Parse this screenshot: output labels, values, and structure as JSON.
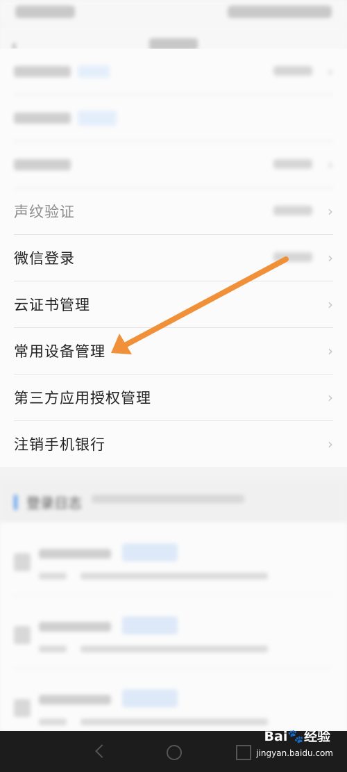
{
  "list": {
    "items": [
      {
        "label": "",
        "blurred": true,
        "has_tag": true,
        "has_status": true
      },
      {
        "label": "",
        "blurred": true,
        "has_tag": true,
        "has_status": false
      },
      {
        "label": "",
        "blurred": true,
        "has_tag": false,
        "has_status": true
      },
      {
        "label": "声纹验证",
        "blurred": false,
        "dim": true,
        "has_tag": false,
        "has_status": true
      },
      {
        "label": "微信登录",
        "blurred": false,
        "dim": false,
        "has_tag": false,
        "has_status": true
      },
      {
        "label": "云证书管理",
        "blurred": false,
        "dim": false,
        "has_tag": false,
        "has_status": false
      },
      {
        "label": "常用设备管理",
        "blurred": false,
        "dim": false,
        "has_tag": false,
        "has_status": false
      },
      {
        "label": "第三方应用授权管理",
        "blurred": false,
        "dim": false,
        "has_tag": false,
        "has_status": false
      },
      {
        "label": "注销手机银行",
        "blurred": false,
        "dim": false,
        "has_tag": false,
        "has_status": false
      }
    ]
  },
  "login_log": {
    "title": "登录日志"
  },
  "annotation": {
    "arrow_color": "#f0913a"
  },
  "watermark": {
    "brand": "Bai🐾经验",
    "url": "jingyan.baidu.com"
  },
  "icons": {
    "back": "back-arrow-icon",
    "chevron": "chevron-right-icon"
  }
}
